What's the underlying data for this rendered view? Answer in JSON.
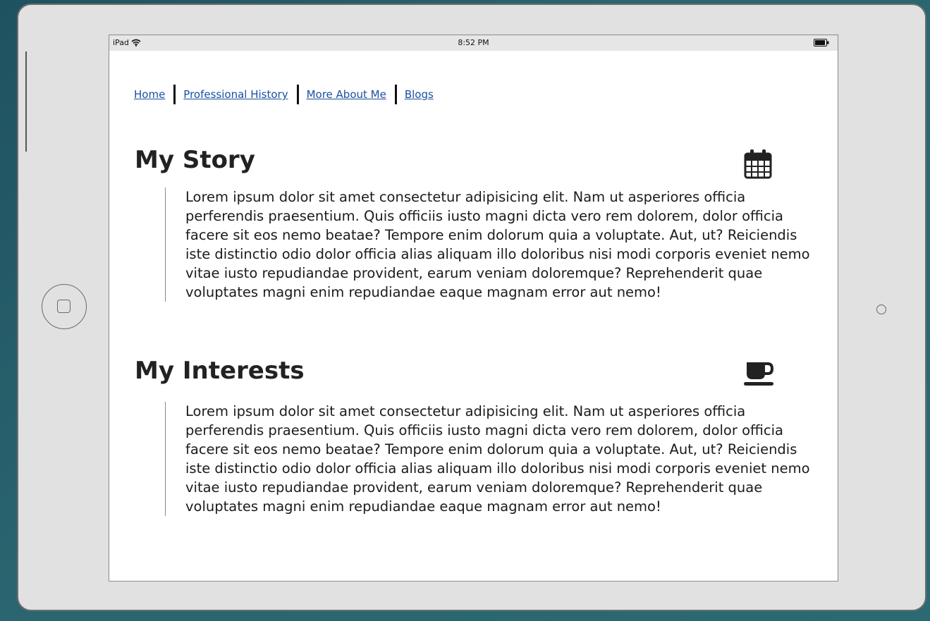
{
  "status_bar": {
    "device": "iPad",
    "time": "8:52 PM"
  },
  "nav": {
    "items": [
      {
        "label": "Home"
      },
      {
        "label": "Professional History"
      },
      {
        "label": "More About Me"
      },
      {
        "label": "Blogs"
      }
    ]
  },
  "sections": [
    {
      "title": "My Story",
      "icon": "calendar-icon",
      "body": "Lorem ipsum dolor sit amet consectetur adipisicing elit. Nam ut asperiores officia perferendis praesentium. Quis officiis iusto magni dicta vero rem dolorem, dolor officia facere sit eos nemo beatae? Tempore enim dolorum quia a voluptate. Aut, ut? Reiciendis iste distinctio odio dolor officia alias aliquam illo doloribus nisi modi corporis eveniet nemo vitae iusto repudiandae provident, earum veniam doloremque? Reprehenderit quae voluptates magni enim repudiandae eaque magnam error aut nemo!"
    },
    {
      "title": "My Interests",
      "icon": "coffee-cup-icon",
      "body": "Lorem ipsum dolor sit amet consectetur adipisicing elit. Nam ut asperiores officia perferendis praesentium. Quis officiis iusto magni dicta vero rem dolorem, dolor officia facere sit eos nemo beatae? Tempore enim dolorum quia a voluptate. Aut, ut? Reiciendis iste distinctio odio dolor officia alias aliquam illo doloribus nisi modi corporis eveniet nemo vitae iusto repudiandae provident, earum veniam doloremque? Reprehenderit quae voluptates magni enim repudiandae eaque magnam error aut nemo!"
    }
  ],
  "colors": {
    "link": "#1a4fa0",
    "heading": "#222222",
    "background": "#2a6570"
  }
}
